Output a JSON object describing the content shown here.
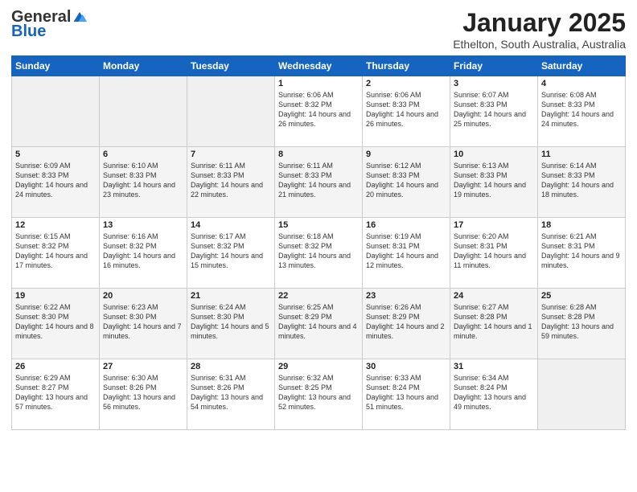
{
  "header": {
    "logo_general": "General",
    "logo_blue": "Blue",
    "month": "January 2025",
    "location": "Ethelton, South Australia, Australia"
  },
  "days_of_week": [
    "Sunday",
    "Monday",
    "Tuesday",
    "Wednesday",
    "Thursday",
    "Friday",
    "Saturday"
  ],
  "weeks": [
    [
      {
        "day": "",
        "sunrise": "",
        "sunset": "",
        "daylight": "",
        "empty": true
      },
      {
        "day": "",
        "sunrise": "",
        "sunset": "",
        "daylight": "",
        "empty": true
      },
      {
        "day": "",
        "sunrise": "",
        "sunset": "",
        "daylight": "",
        "empty": true
      },
      {
        "day": "1",
        "sunrise": "6:06 AM",
        "sunset": "8:32 PM",
        "daylight": "14 hours and 26 minutes.",
        "empty": false
      },
      {
        "day": "2",
        "sunrise": "6:06 AM",
        "sunset": "8:33 PM",
        "daylight": "14 hours and 26 minutes.",
        "empty": false
      },
      {
        "day": "3",
        "sunrise": "6:07 AM",
        "sunset": "8:33 PM",
        "daylight": "14 hours and 25 minutes.",
        "empty": false
      },
      {
        "day": "4",
        "sunrise": "6:08 AM",
        "sunset": "8:33 PM",
        "daylight": "14 hours and 24 minutes.",
        "empty": false
      }
    ],
    [
      {
        "day": "5",
        "sunrise": "6:09 AM",
        "sunset": "8:33 PM",
        "daylight": "14 hours and 24 minutes.",
        "empty": false
      },
      {
        "day": "6",
        "sunrise": "6:10 AM",
        "sunset": "8:33 PM",
        "daylight": "14 hours and 23 minutes.",
        "empty": false
      },
      {
        "day": "7",
        "sunrise": "6:11 AM",
        "sunset": "8:33 PM",
        "daylight": "14 hours and 22 minutes.",
        "empty": false
      },
      {
        "day": "8",
        "sunrise": "6:11 AM",
        "sunset": "8:33 PM",
        "daylight": "14 hours and 21 minutes.",
        "empty": false
      },
      {
        "day": "9",
        "sunrise": "6:12 AM",
        "sunset": "8:33 PM",
        "daylight": "14 hours and 20 minutes.",
        "empty": false
      },
      {
        "day": "10",
        "sunrise": "6:13 AM",
        "sunset": "8:33 PM",
        "daylight": "14 hours and 19 minutes.",
        "empty": false
      },
      {
        "day": "11",
        "sunrise": "6:14 AM",
        "sunset": "8:33 PM",
        "daylight": "14 hours and 18 minutes.",
        "empty": false
      }
    ],
    [
      {
        "day": "12",
        "sunrise": "6:15 AM",
        "sunset": "8:32 PM",
        "daylight": "14 hours and 17 minutes.",
        "empty": false
      },
      {
        "day": "13",
        "sunrise": "6:16 AM",
        "sunset": "8:32 PM",
        "daylight": "14 hours and 16 minutes.",
        "empty": false
      },
      {
        "day": "14",
        "sunrise": "6:17 AM",
        "sunset": "8:32 PM",
        "daylight": "14 hours and 15 minutes.",
        "empty": false
      },
      {
        "day": "15",
        "sunrise": "6:18 AM",
        "sunset": "8:32 PM",
        "daylight": "14 hours and 13 minutes.",
        "empty": false
      },
      {
        "day": "16",
        "sunrise": "6:19 AM",
        "sunset": "8:31 PM",
        "daylight": "14 hours and 12 minutes.",
        "empty": false
      },
      {
        "day": "17",
        "sunrise": "6:20 AM",
        "sunset": "8:31 PM",
        "daylight": "14 hours and 11 minutes.",
        "empty": false
      },
      {
        "day": "18",
        "sunrise": "6:21 AM",
        "sunset": "8:31 PM",
        "daylight": "14 hours and 9 minutes.",
        "empty": false
      }
    ],
    [
      {
        "day": "19",
        "sunrise": "6:22 AM",
        "sunset": "8:30 PM",
        "daylight": "14 hours and 8 minutes.",
        "empty": false
      },
      {
        "day": "20",
        "sunrise": "6:23 AM",
        "sunset": "8:30 PM",
        "daylight": "14 hours and 7 minutes.",
        "empty": false
      },
      {
        "day": "21",
        "sunrise": "6:24 AM",
        "sunset": "8:30 PM",
        "daylight": "14 hours and 5 minutes.",
        "empty": false
      },
      {
        "day": "22",
        "sunrise": "6:25 AM",
        "sunset": "8:29 PM",
        "daylight": "14 hours and 4 minutes.",
        "empty": false
      },
      {
        "day": "23",
        "sunrise": "6:26 AM",
        "sunset": "8:29 PM",
        "daylight": "14 hours and 2 minutes.",
        "empty": false
      },
      {
        "day": "24",
        "sunrise": "6:27 AM",
        "sunset": "8:28 PM",
        "daylight": "14 hours and 1 minute.",
        "empty": false
      },
      {
        "day": "25",
        "sunrise": "6:28 AM",
        "sunset": "8:28 PM",
        "daylight": "13 hours and 59 minutes.",
        "empty": false
      }
    ],
    [
      {
        "day": "26",
        "sunrise": "6:29 AM",
        "sunset": "8:27 PM",
        "daylight": "13 hours and 57 minutes.",
        "empty": false
      },
      {
        "day": "27",
        "sunrise": "6:30 AM",
        "sunset": "8:26 PM",
        "daylight": "13 hours and 56 minutes.",
        "empty": false
      },
      {
        "day": "28",
        "sunrise": "6:31 AM",
        "sunset": "8:26 PM",
        "daylight": "13 hours and 54 minutes.",
        "empty": false
      },
      {
        "day": "29",
        "sunrise": "6:32 AM",
        "sunset": "8:25 PM",
        "daylight": "13 hours and 52 minutes.",
        "empty": false
      },
      {
        "day": "30",
        "sunrise": "6:33 AM",
        "sunset": "8:24 PM",
        "daylight": "13 hours and 51 minutes.",
        "empty": false
      },
      {
        "day": "31",
        "sunrise": "6:34 AM",
        "sunset": "8:24 PM",
        "daylight": "13 hours and 49 minutes.",
        "empty": false
      },
      {
        "day": "",
        "sunrise": "",
        "sunset": "",
        "daylight": "",
        "empty": true
      }
    ]
  ]
}
